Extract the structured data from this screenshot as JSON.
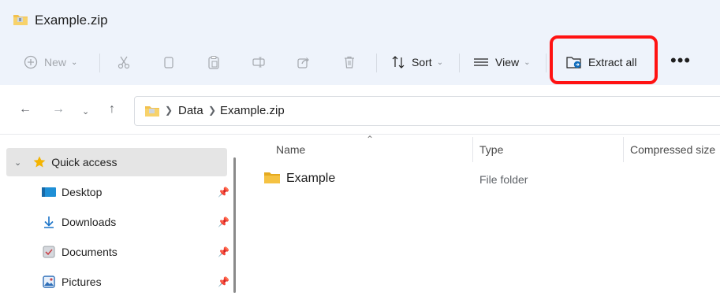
{
  "window": {
    "title": "Example.zip"
  },
  "toolbar": {
    "new_label": "New",
    "cut_icon": "scissors-icon",
    "copy_icon": "copy-icon",
    "paste_icon": "paste-icon",
    "rename_icon": "rename-icon",
    "share_icon": "share-icon",
    "delete_icon": "trash-icon",
    "sort_label": "Sort",
    "view_label": "View",
    "extract_label": "Extract all",
    "more_label": "•••"
  },
  "address": {
    "crumbs": [
      "Data",
      "Example.zip"
    ]
  },
  "sidebar": {
    "items": [
      {
        "label": "Quick access",
        "icon": "star-icon",
        "pinned": false
      },
      {
        "label": "Desktop",
        "icon": "desktop-icon",
        "pinned": true
      },
      {
        "label": "Downloads",
        "icon": "download-icon",
        "pinned": true
      },
      {
        "label": "Documents",
        "icon": "documents-icon",
        "pinned": true
      },
      {
        "label": "Pictures",
        "icon": "pictures-icon",
        "pinned": true
      }
    ]
  },
  "columns": {
    "name": "Name",
    "type": "Type",
    "compressed_size": "Compressed size"
  },
  "rows": [
    {
      "name": "Example",
      "type": "File folder",
      "icon": "folder-icon"
    }
  ],
  "colors": {
    "highlight": "#ff1212",
    "accent": "#0f6cbd",
    "folder": "#f5c242"
  }
}
